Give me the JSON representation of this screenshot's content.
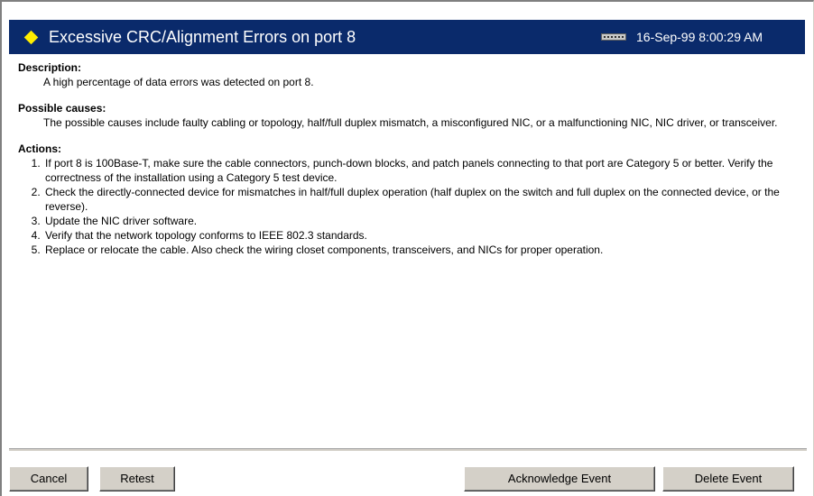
{
  "header": {
    "title": "Excessive CRC/Alignment Errors on port 8",
    "timestamp": "16-Sep-99 8:00:29 AM",
    "icons": [
      "alert-diamond-icon",
      "network-device-icon"
    ],
    "colors": {
      "background": "#0a2a6b",
      "diamond": "#ffee00"
    }
  },
  "description": {
    "heading": "Description:",
    "text": "A high percentage of data errors was detected on port 8."
  },
  "causes": {
    "heading": "Possible causes:",
    "text": "The possible causes include faulty cabling or topology, half/full duplex mismatch, a misconfigured NIC, or a malfunctioning NIC, NIC driver, or transceiver."
  },
  "actions": {
    "heading": "Actions:",
    "items": [
      "If port 8 is 100Base-T, make sure the cable connectors, punch-down blocks, and patch panels connecting to that port are Category 5 or better. Verify the correctness of the installation using a Category 5 test device.",
      "Check the directly-connected device for mismatches in half/full duplex operation (half duplex on the switch and full duplex on the connected device, or the reverse).",
      "Update the NIC driver software.",
      "Verify that the network topology conforms to IEEE 802.3 standards.",
      "Replace or relocate the cable. Also check the wiring closet components, transceivers, and NICs for proper operation."
    ]
  },
  "buttons": {
    "cancel": "Cancel",
    "retest": "Retest",
    "acknowledge": "Acknowledge Event",
    "delete": "Delete Event"
  }
}
